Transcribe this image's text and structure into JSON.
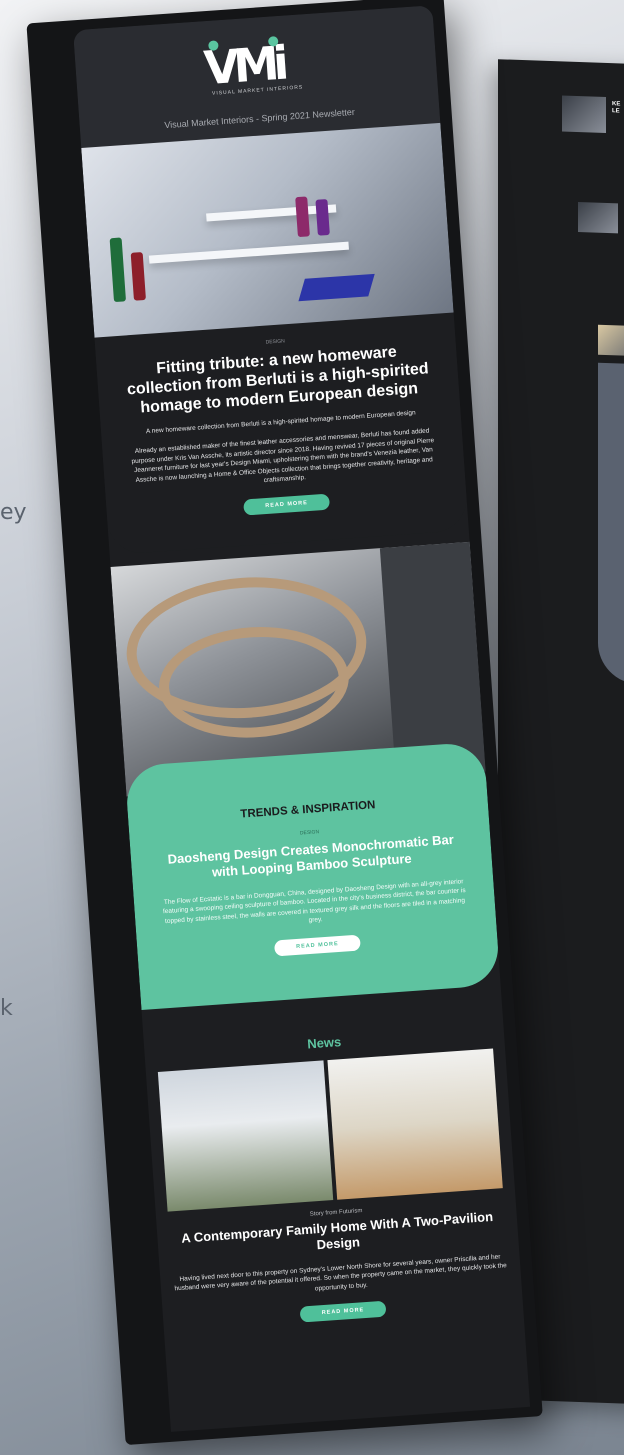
{
  "background": {
    "left_fragments": [
      "ey",
      "k"
    ]
  },
  "newsletter": {
    "brand_logo": "VMi",
    "brand_tagline": "VISUAL MARKET INTERIORS",
    "title": "Visual Market Interiors - Spring 2021 Newsletter",
    "accent_color": "#5ec3a0",
    "feature": {
      "category": "DESIGN",
      "heading": "Fitting tribute: a new homeware collection from Berluti is a high-spirited homage to modern European design",
      "subheading": "A new homeware collection from Berluti is a high-spirited homage to modern European design",
      "body": "Already an established maker of the finest leather accessories and menswear, Berluti has found added purpose under Kris Van Assche, its artistic director since 2018. Having revived 17 pieces of original Pierre Jeanneret furniture for last year's Design Miami, upholstering them with the brand's Venezia leather, Van Assche is now launching a Home & Office Objects collection that brings together creativity, heritage and craftsmanship.",
      "button": "READ MORE"
    },
    "trends": {
      "section_title": "TRENDS & INSPIRATION",
      "category": "DESIGN",
      "heading": "Daosheng Design Creates Monochromatic Bar with Looping Bamboo Sculpture",
      "body": "The Flow of Ecstatic is a bar in Dongguan, China, designed by Daosheng Design with an all-grey interior featuring a swooping ceiling sculpture of bamboo. Located in the city's business district, the bar counter is topped by stainless steel, the walls are covered in textured grey silk and the floors are tiled in a matching grey.",
      "button": "READ MORE"
    },
    "news": {
      "section_title": "News",
      "source": "Story from Futurism",
      "heading": "A Contemporary Family Home With A Two-Pavilion Design",
      "body": "Having lived next door to this property on Sydney's Lower North Shore for several years, owner Priscilla and her husband were very aware of the potential it offered. So when the property came on the market, they quickly took the opportunity to buy.",
      "button": "READ MORE"
    }
  },
  "peek": {
    "article_title": "KE\nLE"
  }
}
